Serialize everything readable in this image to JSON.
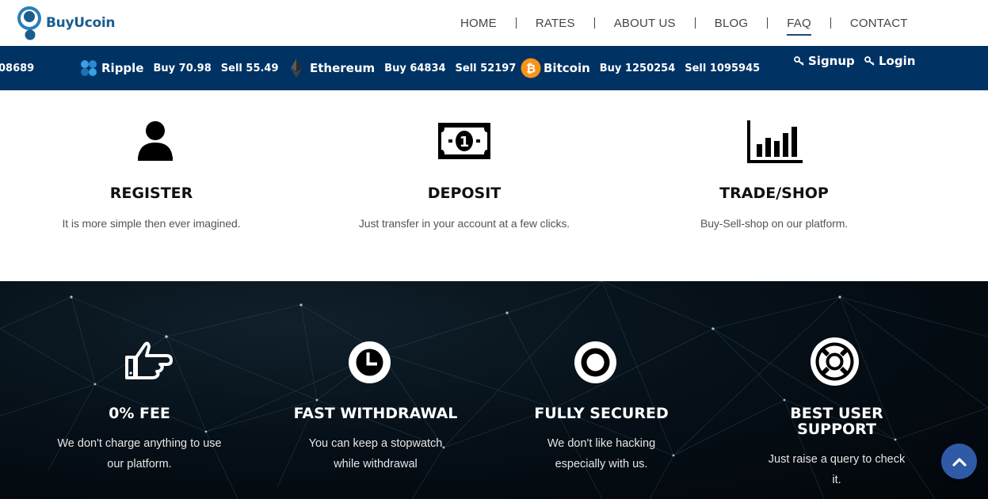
{
  "brand": {
    "name": "BuyUcoin"
  },
  "nav": {
    "items": [
      {
        "label": "HOME"
      },
      {
        "label": "RATES"
      },
      {
        "label": "ABOUT US"
      },
      {
        "label": "BLOG"
      },
      {
        "label": "FAQ",
        "active": true
      },
      {
        "label": "CONTACT"
      }
    ]
  },
  "ticker": {
    "partial": "08689",
    "coins": [
      {
        "name": "Ripple",
        "buy": "Buy 70.98",
        "sell": "Sell 55.49",
        "icon": "ripple-icon"
      },
      {
        "name": "Ethereum",
        "buy": "Buy 64834",
        "sell": "Sell 52197",
        "icon": "ethereum-icon"
      },
      {
        "name": "Bitcoin",
        "buy": "Buy 1250254",
        "sell": "Sell 1095945",
        "icon": "bitcoin-icon"
      }
    ],
    "signup": "Signup",
    "login": "Login"
  },
  "steps": [
    {
      "title": "REGISTER",
      "desc": "It is more simple then ever imagined.",
      "icon": "user-icon"
    },
    {
      "title": "DEPOSIT",
      "desc": "Just transfer in your account at a few clicks.",
      "icon": "banknote-icon"
    },
    {
      "title": "TRADE/SHOP",
      "desc": "Buy-Sell-shop on our platform.",
      "icon": "bar-chart-icon"
    }
  ],
  "features": [
    {
      "title": "0% FEE",
      "desc": [
        "We don't charge anything to use",
        "our platform."
      ],
      "icon": "hand-pointing-icon"
    },
    {
      "title": "FAST WITHDRAWAL",
      "desc": [
        "You can keep a stopwatch",
        "while withdrawal"
      ],
      "icon": "clock-icon"
    },
    {
      "title": "FULLY SECURED",
      "desc": [
        "We don't like hacking",
        "especially with us."
      ],
      "icon": "target-icon"
    },
    {
      "title_lines": [
        "BEST USER",
        "SUPPORT"
      ],
      "desc": [
        "Just raise a query to check",
        "it."
      ],
      "icon": "life-ring-icon"
    }
  ],
  "colors": {
    "ticker_bg": "#003264",
    "brand": "#1a5e8e",
    "scroll_top": "#2f5aa6"
  }
}
